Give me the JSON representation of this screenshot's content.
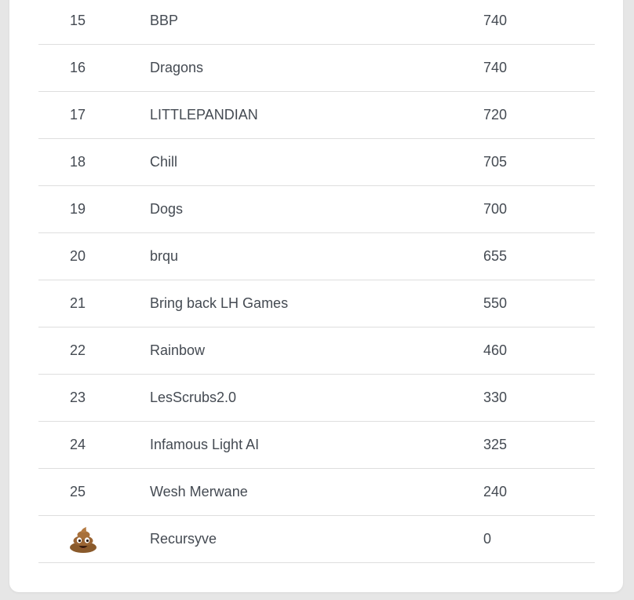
{
  "leaderboard": {
    "rows": [
      {
        "rank": "15",
        "team": "BBP",
        "score": "740"
      },
      {
        "rank": "16",
        "team": "Dragons",
        "score": "740"
      },
      {
        "rank": "17",
        "team": "LITTLEPANDIAN",
        "score": "720"
      },
      {
        "rank": "18",
        "team": "Chill",
        "score": "705"
      },
      {
        "rank": "19",
        "team": "Dogs",
        "score": "700"
      },
      {
        "rank": "20",
        "team": "brqu",
        "score": "655"
      },
      {
        "rank": "21",
        "team": "Bring back LH Games",
        "score": "550"
      },
      {
        "rank": "22",
        "team": "Rainbow",
        "score": "460"
      },
      {
        "rank": "23",
        "team": "LesScrubs2.0",
        "score": "330"
      },
      {
        "rank": "24",
        "team": "Infamous Light AI",
        "score": "325"
      },
      {
        "rank": "25",
        "team": "Wesh Merwane",
        "score": "240"
      },
      {
        "rank_icon": "poop-icon",
        "team": "Recursyve",
        "score": "0"
      }
    ]
  },
  "colors": {
    "page_background": "#e6e6e6",
    "card_background": "#ffffff",
    "row_divider": "#dedede",
    "text": "#444a52"
  }
}
